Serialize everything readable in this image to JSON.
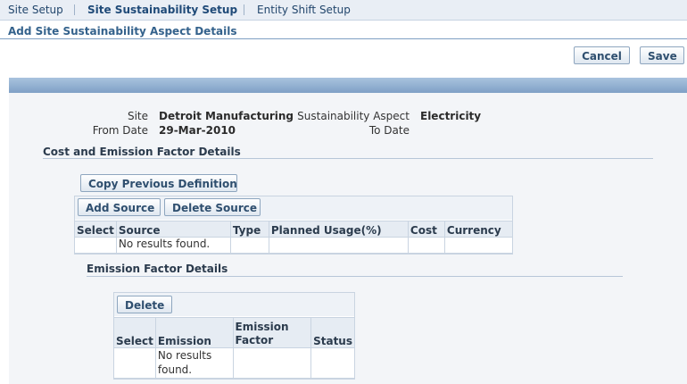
{
  "tabs": [
    {
      "label": "Site Setup"
    },
    {
      "label": "Site Sustainability Setup"
    },
    {
      "label": "Entity Shift Setup"
    }
  ],
  "page_title": "Add Site Sustainability Aspect Details",
  "actions": {
    "cancel": "Cancel",
    "save": "Save"
  },
  "header": {
    "site_label": "Site",
    "site_value": "Detroit Manufacturing",
    "aspect_label": "Sustainability Aspect",
    "aspect_value": "Electricity",
    "from_date_label": "From Date",
    "from_date_value": "29-Mar-2010",
    "to_date_label": "To Date",
    "to_date_value": ""
  },
  "cost_section": {
    "title": "Cost and Emission Factor Details",
    "copy_button": "Copy Previous Definition",
    "add_source": "Add Source",
    "delete_source": "Delete Source",
    "columns": [
      "Select",
      "Source",
      "Type",
      "Planned Usage(%)",
      "Cost",
      "Currency"
    ],
    "empty_text": "No results found."
  },
  "emission_section": {
    "title": "Emission Factor Details",
    "delete_button": "Delete",
    "columns": [
      "Select",
      "Emission",
      "Emission Factor",
      "Status"
    ],
    "empty_text": "No results found."
  }
}
